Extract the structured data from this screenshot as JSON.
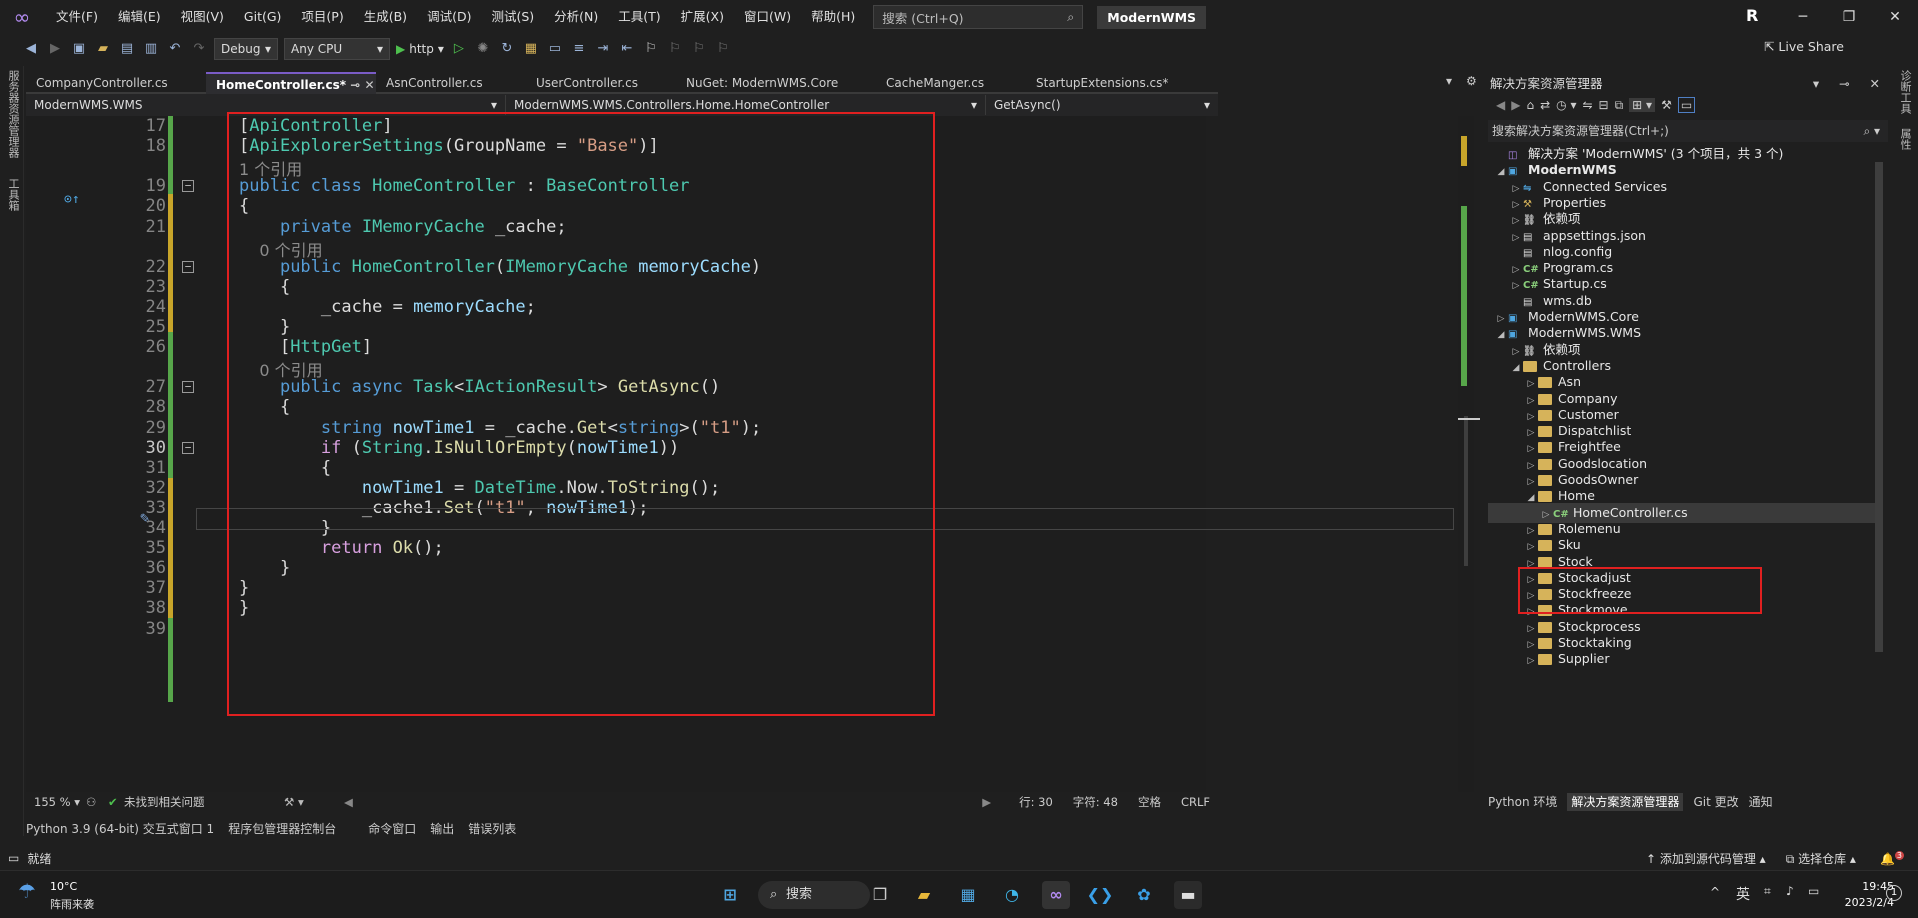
{
  "titlebar": {
    "menus": [
      "文件(F)",
      "编辑(E)",
      "视图(V)",
      "Git(G)",
      "项目(P)",
      "生成(B)",
      "调试(D)",
      "测试(S)",
      "分析(N)",
      "工具(T)",
      "扩展(X)",
      "窗口(W)",
      "帮助(H)"
    ],
    "search_placeholder": "搜索 (Ctrl+Q)",
    "solution_name": "ModernWMS",
    "avatar_letter": "R"
  },
  "toolbar": {
    "config": "Debug",
    "platform": "Any CPU",
    "run_label": "http",
    "live_share": "Live Share"
  },
  "left_rail": {
    "item1": "服务器资源管理器",
    "item2": "工具箱"
  },
  "right_rail": {
    "item1": "诊断工具",
    "item2": "属性"
  },
  "doc_tabs": [
    {
      "label": "CompanyController.cs",
      "active": false
    },
    {
      "label": "HomeController.cs*",
      "active": true
    },
    {
      "label": "AsnController.cs",
      "active": false
    },
    {
      "label": "UserController.cs",
      "active": false
    },
    {
      "label": "NuGet: ModernWMS.Core",
      "active": false
    },
    {
      "label": "CacheManger.cs",
      "active": false
    },
    {
      "label": "StartupExtensions.cs*",
      "active": false
    }
  ],
  "nav_bar": {
    "project": "ModernWMS.WMS",
    "class": "ModernWMS.WMS.Controllers.Home.HomeController",
    "member": "GetAsync()"
  },
  "editor": {
    "lines": [
      {
        "n": "17",
        "code": "[ApiController]"
      },
      {
        "n": "18",
        "code": "[ApiExplorerSettings(GroupName = \"Base\")]"
      },
      {
        "n": "",
        "code": "1 个引用",
        "hint": true
      },
      {
        "n": "19",
        "code": "public class HomeController : BaseController"
      },
      {
        "n": "20",
        "code": "{"
      },
      {
        "n": "21",
        "code": "    private IMemoryCache _cache;"
      },
      {
        "n": "",
        "code": "    0 个引用",
        "hint": true
      },
      {
        "n": "22",
        "code": "    public HomeController(IMemoryCache memoryCache)"
      },
      {
        "n": "23",
        "code": "    {"
      },
      {
        "n": "24",
        "code": "        _cache = memoryCache;"
      },
      {
        "n": "25",
        "code": "    }"
      },
      {
        "n": "26",
        "code": "    [HttpGet]"
      },
      {
        "n": "",
        "code": "    0 个引用",
        "hint": true
      },
      {
        "n": "27",
        "code": "    public async Task<IActionResult> GetAsync()"
      },
      {
        "n": "28",
        "code": "    {"
      },
      {
        "n": "29",
        "code": "        string nowTime1 = _cache.Get<string>(\"t1\");"
      },
      {
        "n": "30",
        "code": "        if (String.IsNullOrEmpty(nowTime1))"
      },
      {
        "n": "31",
        "code": "        {"
      },
      {
        "n": "32",
        "code": "            nowTime1 = DateTime.Now.ToString();"
      },
      {
        "n": "33",
        "code": "            _cache1.Set(\"t1\", nowTime1);"
      },
      {
        "n": "34",
        "code": "        }"
      },
      {
        "n": "35",
        "code": "        return Ok();"
      },
      {
        "n": "36",
        "code": "    }"
      },
      {
        "n": "37",
        "code": "}"
      },
      {
        "n": "38",
        "code": "}"
      },
      {
        "n": "39",
        "code": ""
      }
    ]
  },
  "editor_status": {
    "zoom": "155 %",
    "issues": "未找到相关问题",
    "line": "行: 30",
    "char": "字符: 48",
    "spacing": "空格",
    "eol": "CRLF"
  },
  "bottom_tabs": [
    "Python 3.9 (64-bit) 交互式窗口 1",
    "程序包管理器控制台",
    "命令窗口",
    "输出",
    "错误列表"
  ],
  "solution_explorer": {
    "title": "解决方案资源管理器",
    "search": "搜索解决方案资源管理器(Ctrl+;)",
    "tree": [
      {
        "label": "解决方案 'ModernWMS' (3 个项目，共 3 个)",
        "indent": 0,
        "arrow": "",
        "icon": "solution"
      },
      {
        "label": "ModernWMS",
        "indent": 0,
        "arrow": "◢",
        "icon": "project",
        "bold": true
      },
      {
        "label": "Connected Services",
        "indent": 1,
        "arrow": "▷",
        "icon": "service"
      },
      {
        "label": "Properties",
        "indent": 1,
        "arrow": "▷",
        "icon": "props"
      },
      {
        "label": "依赖项",
        "indent": 1,
        "arrow": "▷",
        "icon": "deps"
      },
      {
        "label": "appsettings.json",
        "indent": 1,
        "arrow": "▷",
        "icon": "file"
      },
      {
        "label": "nlog.config",
        "indent": 1,
        "arrow": "",
        "icon": "file"
      },
      {
        "label": "Program.cs",
        "indent": 1,
        "arrow": "▷",
        "icon": "cs"
      },
      {
        "label": "Startup.cs",
        "indent": 1,
        "arrow": "▷",
        "icon": "cs"
      },
      {
        "label": "wms.db",
        "indent": 1,
        "arrow": "",
        "icon": "file"
      },
      {
        "label": "ModernWMS.Core",
        "indent": 0,
        "arrow": "▷",
        "icon": "project"
      },
      {
        "label": "ModernWMS.WMS",
        "indent": 0,
        "arrow": "◢",
        "icon": "project"
      },
      {
        "label": "依赖项",
        "indent": 1,
        "arrow": "▷",
        "icon": "deps"
      },
      {
        "label": "Controllers",
        "indent": 1,
        "arrow": "◢",
        "icon": "folder"
      },
      {
        "label": "Asn",
        "indent": 2,
        "arrow": "▷",
        "icon": "folder"
      },
      {
        "label": "Company",
        "indent": 2,
        "arrow": "▷",
        "icon": "folder"
      },
      {
        "label": "Customer",
        "indent": 2,
        "arrow": "▷",
        "icon": "folder"
      },
      {
        "label": "Dispatchlist",
        "indent": 2,
        "arrow": "▷",
        "icon": "folder"
      },
      {
        "label": "Freightfee",
        "indent": 2,
        "arrow": "▷",
        "icon": "folder"
      },
      {
        "label": "Goodslocation",
        "indent": 2,
        "arrow": "▷",
        "icon": "folder"
      },
      {
        "label": "GoodsOwner",
        "indent": 2,
        "arrow": "▷",
        "icon": "folder"
      },
      {
        "label": "Home",
        "indent": 2,
        "arrow": "◢",
        "icon": "folder"
      },
      {
        "label": "HomeController.cs",
        "indent": 3,
        "arrow": "▷",
        "icon": "cs",
        "selected": true
      },
      {
        "label": "Rolemenu",
        "indent": 2,
        "arrow": "▷",
        "icon": "folder"
      },
      {
        "label": "Sku",
        "indent": 2,
        "arrow": "▷",
        "icon": "folder"
      },
      {
        "label": "Stock",
        "indent": 2,
        "arrow": "▷",
        "icon": "folder"
      },
      {
        "label": "Stockadjust",
        "indent": 2,
        "arrow": "▷",
        "icon": "folder"
      },
      {
        "label": "Stockfreeze",
        "indent": 2,
        "arrow": "▷",
        "icon": "folder"
      },
      {
        "label": "Stockmove",
        "indent": 2,
        "arrow": "▷",
        "icon": "folder"
      },
      {
        "label": "Stockprocess",
        "indent": 2,
        "arrow": "▷",
        "icon": "folder"
      },
      {
        "label": "Stocktaking",
        "indent": 2,
        "arrow": "▷",
        "icon": "folder"
      },
      {
        "label": "Supplier",
        "indent": 2,
        "arrow": "▷",
        "icon": "folder"
      }
    ],
    "tabs": [
      "Python 环境",
      "解决方案资源管理器",
      "Git 更改",
      "通知"
    ]
  },
  "status_bar": {
    "ready": "就绪",
    "source_control": "添加到源代码管理",
    "repo": "选择仓库",
    "notif_count": "3"
  },
  "taskbar": {
    "weather_temp": "10°C",
    "weather_desc": "阵雨来袭",
    "search": "搜索",
    "ime": "英",
    "time": "19:45",
    "date": "2023/2/4",
    "notif": "1"
  },
  "colors": {
    "accent": "#7a5cc7",
    "highlight_box": "#e02020"
  }
}
